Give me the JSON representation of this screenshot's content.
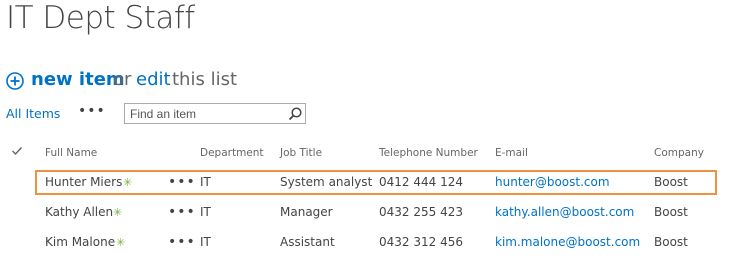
{
  "list": {
    "title": "IT Dept Staff",
    "new_item_label": "new item",
    "or_text": "or",
    "edit_label": "edit",
    "this_list_text": "this list"
  },
  "views": {
    "current": "All Items",
    "more_label": "•••"
  },
  "search": {
    "placeholder": "Find an item"
  },
  "columns": [
    "Full Name",
    "Department",
    "Job Title",
    "Telephone Number",
    "E-mail",
    "Company"
  ],
  "rows": [
    {
      "name": "Hunter Miers",
      "new_badge": "✳",
      "menu": "•••",
      "department": "IT",
      "job_title": "System analyst",
      "phone": "0412 444 124",
      "email": "hunter@boost.com",
      "company": "Boost",
      "highlighted": true
    },
    {
      "name": "Kathy Allen",
      "new_badge": "✳",
      "menu": "•••",
      "department": "IT",
      "job_title": "Manager",
      "phone": "0432 255 423",
      "email": "kathy.allen@boost.com",
      "company": "Boost",
      "highlighted": false
    },
    {
      "name": "Kim Malone",
      "new_badge": "✳",
      "menu": "•••",
      "department": "IT",
      "job_title": "Assistant",
      "phone": "0432 312 456",
      "email": "kim.malone@boost.com",
      "company": "Boost",
      "highlighted": false
    }
  ],
  "colors": {
    "link": "#0072c6",
    "highlight_border": "#f0923c",
    "new_badge": "#70b23e"
  }
}
